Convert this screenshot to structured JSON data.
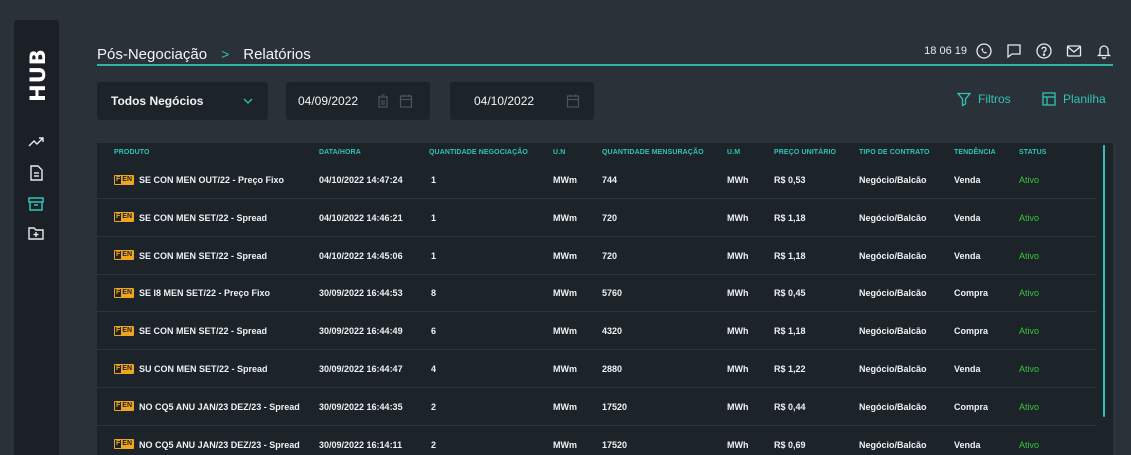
{
  "sidebar": {
    "logo": "HUB",
    "icons": [
      "chart-line-icon",
      "document-icon",
      "archive-icon",
      "folder-plus-icon"
    ]
  },
  "header": {
    "crumb1": "Pós-Negociação",
    "separator": ">",
    "crumb2": "Relatórios",
    "time": "18 06 19"
  },
  "filters": {
    "select_value": "Todos Negócios",
    "date_from": "04/09/2022",
    "date_to": "04/10/2022",
    "filtros_label": "Filtros",
    "planilha_label": "Planilha"
  },
  "table": {
    "headers": {
      "produto": "PRODUTO",
      "datahora": "DATA/HORA",
      "qtd_neg": "QUANTIDADE NEGOCIAÇÃO",
      "un1": "U.N",
      "qtd_mens": "QUANTIDADE MENSURAÇÃO",
      "um": "U.M",
      "preco": "PREÇO UNITÁRIO",
      "tipo": "TIPO DE CONTRATO",
      "tendencia": "TENDÊNCIA",
      "status": "STATUS"
    },
    "badge_f": "F",
    "badge_en": "EN",
    "rows": [
      {
        "produto": "SE CON MEN OUT/22 - Preço Fixo",
        "datahora": "04/10/2022 14:47:24",
        "qtd": "1",
        "un": "MWm",
        "mens": "744",
        "um": "MWh",
        "preco": "R$ 0,53",
        "tipo": "Negócio/Balcão",
        "tend": "Venda",
        "status": "Ativo"
      },
      {
        "produto": "SE CON MEN SET/22 - Spread",
        "datahora": "04/10/2022 14:46:21",
        "qtd": "1",
        "un": "MWm",
        "mens": "720",
        "um": "MWh",
        "preco": "R$ 1,18",
        "tipo": "Negócio/Balcão",
        "tend": "Venda",
        "status": "Ativo"
      },
      {
        "produto": "SE CON MEN SET/22 - Spread",
        "datahora": "04/10/2022 14:45:06",
        "qtd": "1",
        "un": "MWm",
        "mens": "720",
        "um": "MWh",
        "preco": "R$ 1,18",
        "tipo": "Negócio/Balcão",
        "tend": "Venda",
        "status": "Ativo"
      },
      {
        "produto": "SE I8 MEN SET/22 - Preço Fixo",
        "datahora": "30/09/2022 16:44:53",
        "qtd": "8",
        "un": "MWm",
        "mens": "5760",
        "um": "MWh",
        "preco": "R$ 0,45",
        "tipo": "Negócio/Balcão",
        "tend": "Compra",
        "status": "Ativo"
      },
      {
        "produto": "SE CON MEN SET/22 - Spread",
        "datahora": "30/09/2022 16:44:49",
        "qtd": "6",
        "un": "MWm",
        "mens": "4320",
        "um": "MWh",
        "preco": "R$ 1,18",
        "tipo": "Negócio/Balcão",
        "tend": "Compra",
        "status": "Ativo"
      },
      {
        "produto": "SU CON MEN SET/22 - Spread",
        "datahora": "30/09/2022 16:44:47",
        "qtd": "4",
        "un": "MWm",
        "mens": "2880",
        "um": "MWh",
        "preco": "R$ 1,22",
        "tipo": "Negócio/Balcão",
        "tend": "Venda",
        "status": "Ativo"
      },
      {
        "produto": "NO CQ5 ANU JAN/23 DEZ/23 - Spread",
        "datahora": "30/09/2022 16:44:35",
        "qtd": "2",
        "un": "MWm",
        "mens": "17520",
        "um": "MWh",
        "preco": "R$ 0,44",
        "tipo": "Negócio/Balcão",
        "tend": "Compra",
        "status": "Ativo"
      },
      {
        "produto": "NO CQ5 ANU JAN/23 DEZ/23 - Spread",
        "datahora": "30/09/2022 16:14:11",
        "qtd": "2",
        "un": "MWm",
        "mens": "17520",
        "um": "MWh",
        "preco": "R$ 0,69",
        "tipo": "Negócio/Balcão",
        "tend": "Venda",
        "status": "Ativo"
      }
    ]
  },
  "colors": {
    "accent": "#2fc4b5",
    "status_active": "#37c73a",
    "badge": "#f0a51c",
    "panel": "#1c2329",
    "background": "#2b3138"
  }
}
